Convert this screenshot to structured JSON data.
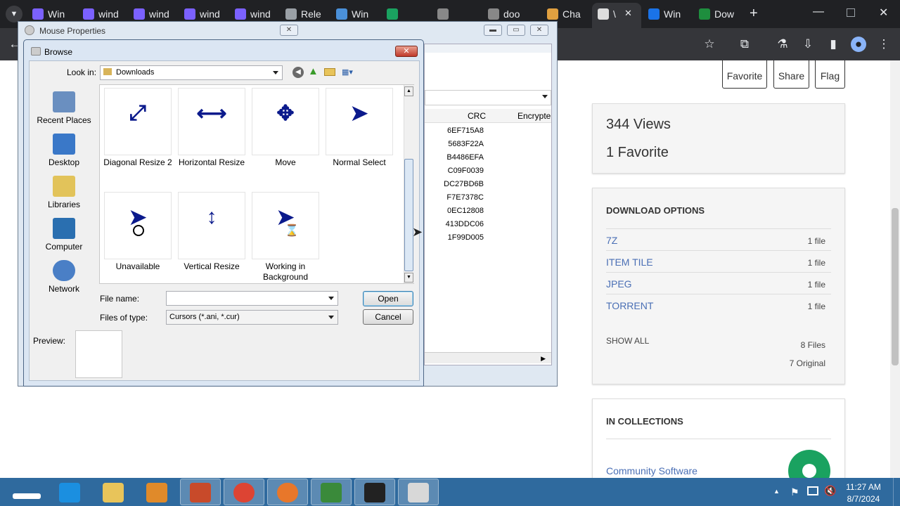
{
  "browser": {
    "tabs": [
      {
        "label": "Win",
        "color": "#7b61ff"
      },
      {
        "label": "wind",
        "color": "#7b61ff"
      },
      {
        "label": "wind",
        "color": "#7b61ff"
      },
      {
        "label": "wind",
        "color": "#7b61ff"
      },
      {
        "label": "wind",
        "color": "#7b61ff"
      },
      {
        "label": "Rele",
        "color": "#9aa0a6"
      },
      {
        "label": "Win",
        "color": "#4a90d9"
      },
      {
        "label": "",
        "color": "#1aa260"
      },
      {
        "label": "",
        "color": "#888888"
      },
      {
        "label": "doo",
        "color": "#888888"
      },
      {
        "label": "Cha",
        "color": "#e0a040"
      },
      {
        "label": "\\",
        "color": "#dddddd"
      },
      {
        "label": "Win",
        "color": "#1a73e8"
      },
      {
        "label": "Dow",
        "color": "#1e8e3e"
      }
    ],
    "new_tab": "+",
    "close_tab": "✕"
  },
  "page": {
    "actions": {
      "favorite": "Favorite",
      "share": "Share",
      "flag": "Flag"
    },
    "stats": {
      "views": "344 Views",
      "favorites": "1 Favorite"
    },
    "download": {
      "title": "DOWNLOAD OPTIONS",
      "items": [
        {
          "label": "7Z",
          "count": "1 file"
        },
        {
          "label": "ITEM TILE",
          "count": "1 file"
        },
        {
          "label": "JPEG",
          "count": "1 file"
        },
        {
          "label": "TORRENT",
          "count": "1 file"
        }
      ],
      "show_all": "SHOW ALL",
      "total_files": "8 Files",
      "original": "7 Original"
    },
    "collections": {
      "title": "IN COLLECTIONS",
      "item": "Community Software"
    }
  },
  "mouse_properties": {
    "title": "Mouse Properties",
    "columns": {
      "crc": "CRC",
      "encrypted": "Encrypte"
    },
    "crc_values": [
      "6EF715A8",
      "5683F22A",
      "B4486EFA",
      "C09F0039",
      "DC27BD6B",
      "F7E7378C",
      "0EC12808",
      "413DDC06",
      "1F99D005"
    ]
  },
  "browse": {
    "title": "Browse",
    "look_in_label": "Look in:",
    "look_in_value": "Downloads",
    "places": [
      "Recent Places",
      "Desktop",
      "Libraries",
      "Computer",
      "Network"
    ],
    "files": [
      {
        "name": "Diagonal Resize 2"
      },
      {
        "name": "Horizontal Resize"
      },
      {
        "name": "Move"
      },
      {
        "name": "Normal Select"
      },
      {
        "name": "Unavailable"
      },
      {
        "name": "Vertical Resize"
      },
      {
        "name": "Working in Background"
      }
    ],
    "file_name_label": "File name:",
    "file_name_value": "",
    "file_type_label": "Files of type:",
    "file_type_value": "Cursors (*.ani, *.cur)",
    "open": "Open",
    "cancel": "Cancel",
    "preview_label": "Preview:"
  },
  "taskbar": {
    "time": "11:27 AM",
    "date": "8/7/2024",
    "apps": [
      "internet-explorer",
      "file-explorer",
      "media-player",
      "winrar",
      "chrome",
      "firefox",
      "winrar-2",
      "7zip",
      "mouse"
    ]
  }
}
